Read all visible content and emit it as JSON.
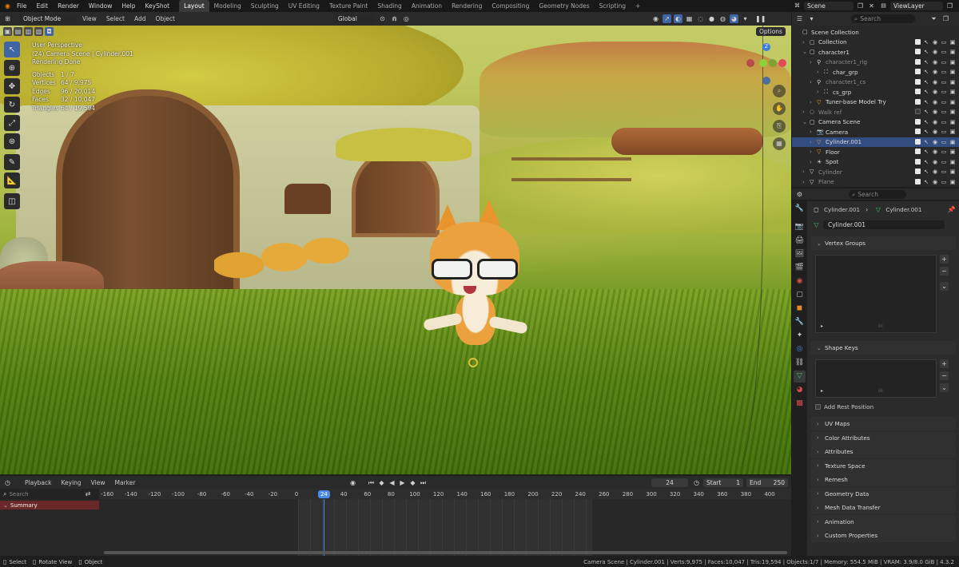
{
  "topbar": {
    "menus": [
      "File",
      "Edit",
      "Render",
      "Window",
      "Help",
      "KeyShot"
    ],
    "workspaces": [
      "Layout",
      "Modeling",
      "Sculpting",
      "UV Editing",
      "Texture Paint",
      "Shading",
      "Animation",
      "Rendering",
      "Compositing",
      "Geometry Nodes",
      "Scripting"
    ],
    "active_workspace": "Layout",
    "add_tab": "+",
    "scene": "Scene",
    "view_layer": "ViewLayer"
  },
  "viewport_header": {
    "mode": "Object Mode",
    "menus": [
      "View",
      "Select",
      "Add",
      "Object"
    ],
    "orientation": "Global",
    "options": "Options"
  },
  "overlay": {
    "line1": "User Perspective",
    "line2": "(24) Camera Scene | Cylinder.001",
    "line3": "Rendering Done",
    "stats": [
      {
        "k": "Objects",
        "v": "1 / 7"
      },
      {
        "k": "Vertices",
        "v": "64 / 9,975"
      },
      {
        "k": "Edges",
        "v": "96 / 20,014"
      },
      {
        "k": "Faces",
        "v": "32 / 10,047"
      },
      {
        "k": "Triangles",
        "v": "64 / 19,594"
      }
    ]
  },
  "gizmo": {
    "z": "Z"
  },
  "outliner": {
    "search_placeholder": "Search",
    "rows": [
      {
        "label": "Scene Collection",
        "indent": 0
      },
      {
        "label": "Collection",
        "indent": 1
      },
      {
        "label": "character1",
        "indent": 1
      },
      {
        "label": "character1_rig",
        "indent": 2
      },
      {
        "label": "char_grp",
        "indent": 3
      },
      {
        "label": "character1_cs",
        "indent": 2
      },
      {
        "label": "cs_grp",
        "indent": 3
      },
      {
        "label": "Tuner-base Model Try",
        "indent": 2
      },
      {
        "label": "Walk ref",
        "indent": 1
      },
      {
        "label": "Camera Scene",
        "indent": 1
      },
      {
        "label": "Camera",
        "indent": 2
      },
      {
        "label": "Cylinder.001",
        "indent": 2
      },
      {
        "label": "Floor",
        "indent": 2
      },
      {
        "label": "Spot",
        "indent": 2
      },
      {
        "label": "Cylinder",
        "indent": 1
      },
      {
        "label": "Plane",
        "indent": 1
      }
    ]
  },
  "properties": {
    "search_placeholder": "Search",
    "breadcrumb_obj": "Cylinder.001",
    "breadcrumb_data": "Cylinder.001",
    "data_name": "Cylinder.001",
    "vertex_groups": "Vertex Groups",
    "shape_keys": "Shape Keys",
    "add_rest_position": "Add Rest Position",
    "panels": [
      "UV Maps",
      "Color Attributes",
      "Attributes",
      "Texture Space",
      "Remesh",
      "Geometry Data",
      "Mesh Data Transfer",
      "Animation",
      "Custom Properties"
    ]
  },
  "timeline": {
    "menus": [
      "Playback",
      "Keying",
      "View",
      "Marker"
    ],
    "current_frame": "24",
    "start_label": "Start",
    "start": "1",
    "end_label": "End",
    "end": "250",
    "search_placeholder": "Search",
    "summary": "Summary",
    "ticks": [
      "-160",
      "-140",
      "-120",
      "-100",
      "-80",
      "-60",
      "-40",
      "-20",
      "0",
      "40",
      "60",
      "80",
      "100",
      "120",
      "140",
      "160",
      "180",
      "200",
      "220",
      "240",
      "260",
      "280",
      "300",
      "320",
      "340",
      "360",
      "380",
      "400"
    ],
    "playhead": "24"
  },
  "statusbar": {
    "left": [
      "Select",
      "Rotate View",
      "Object"
    ],
    "right": "Camera Scene | Cylinder.001 | Verts:9,975 | Faces:10,047 | Tris:19,594 | Objects:1/7 | Memory: 554.5 MiB | VRAM: 3.9/8.0 GiB | 4.3.2"
  },
  "colors": {
    "accent": "#4772b3",
    "selection": "#334d80",
    "playhead": "#4a8ae8",
    "summary": "#7a2a2a"
  }
}
